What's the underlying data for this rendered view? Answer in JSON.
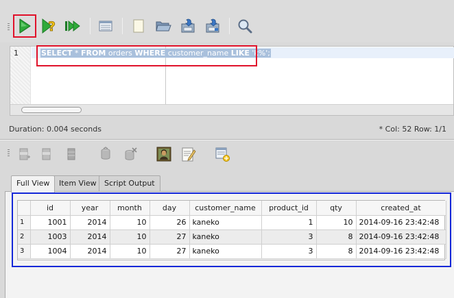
{
  "toolbar": {
    "buttons": [
      {
        "name": "execute-icon"
      },
      {
        "name": "explain-icon"
      },
      {
        "name": "execute-script-icon"
      },
      {
        "name": "query-builder-icon"
      },
      {
        "name": "new-file-icon"
      },
      {
        "name": "open-file-icon"
      },
      {
        "name": "save-icon"
      },
      {
        "name": "save-as-icon"
      },
      {
        "name": "find-icon"
      }
    ]
  },
  "editor": {
    "line_number": "1",
    "sql": {
      "k1": "SELECT",
      "t1": " * ",
      "k2": "FROM",
      "t2": " orders ",
      "k3": "WHERE",
      "t3": " customer_name ",
      "k4": "LIKE",
      "t4": " 'k%';"
    }
  },
  "status": {
    "duration": "Duration: 0.004 seconds",
    "position": "*   Col: 52 Row: 1/1"
  },
  "tabs": [
    {
      "label": "Full View",
      "active": true
    },
    {
      "label": "Item View",
      "active": false
    },
    {
      "label": "Script Output",
      "active": false
    }
  ],
  "results": {
    "columns": [
      "id",
      "year",
      "month",
      "day",
      "customer_name",
      "product_id",
      "qty",
      "created_at"
    ],
    "rows": [
      {
        "num": "1",
        "cells": [
          "1001",
          "2014",
          "10",
          "26",
          "kaneko",
          "1",
          "10",
          "2014-09-16 23:42:48"
        ]
      },
      {
        "num": "2",
        "cells": [
          "1003",
          "2014",
          "10",
          "27",
          "kaneko",
          "3",
          "8",
          "2014-09-16 23:42:48"
        ]
      },
      {
        "num": "3",
        "cells": [
          "1004",
          "2014",
          "10",
          "27",
          "kaneko",
          "3",
          "8",
          "2014-09-16 23:42:48"
        ]
      }
    ]
  },
  "colors": {
    "highlight_red": "#e0112a",
    "highlight_blue": "#1327d8",
    "selection": "#a9c0dc"
  }
}
